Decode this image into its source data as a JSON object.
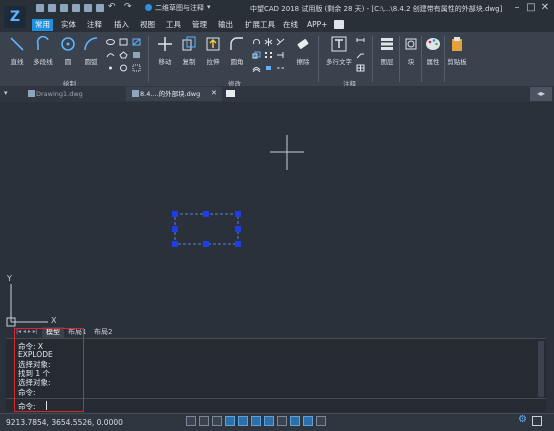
{
  "app": {
    "title": "中望CAD 2018 试用版 (剩余 28 天) - [C:\\...\\8.4.2  创建带有属性的外部块.dwg]",
    "workspace": "二维草图与注释"
  },
  "menu": [
    "常用",
    "实体",
    "注释",
    "插入",
    "视图",
    "工具",
    "管理",
    "输出",
    "扩展工具",
    "在线",
    "APP+"
  ],
  "ribbon": {
    "draw": {
      "label": "绘制",
      "line": "直线",
      "polyline": "多段线",
      "circle": "圆",
      "arc": "圆弧"
    },
    "modify": {
      "label": "修改",
      "move": "移动",
      "copy": "复制",
      "stretch": "拉伸",
      "fillet": "圆角",
      "erase": "擦除"
    },
    "annotate": {
      "label": "注释",
      "mtext": "多行文字"
    },
    "layer": "图层",
    "block": "块",
    "properties": "属性",
    "clipboard": "剪贴板"
  },
  "tabs": {
    "doc1": "Drawing1.dwg",
    "doc2": "8.4....的外部块.dwg"
  },
  "layout_tabs": [
    "模型",
    "布局1",
    "布局2"
  ],
  "command": {
    "lines": [
      "命令: X",
      "EXPLODE",
      "选择对象:",
      "找到 1 个",
      "选择对象:",
      "命令:",
      "命令:"
    ]
  },
  "status": {
    "coords": "9213.7854, 3654.5526, 0.0000"
  },
  "axis": {
    "x": "X",
    "y": "Y"
  },
  "colors": {
    "accent": "#1e8fe1",
    "highlight": "#d8262f",
    "grip": "#1b3ee8"
  }
}
